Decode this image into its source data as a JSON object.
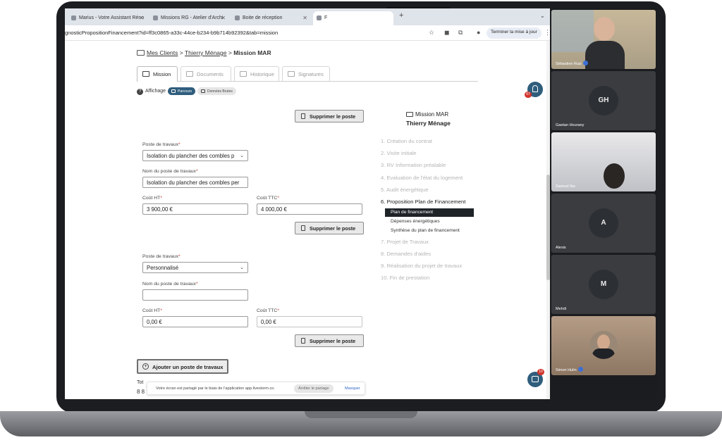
{
  "browser": {
    "tabs": [
      {
        "label": "Marius - Votre Assistant Réno"
      },
      {
        "label": "Missions RG - Atelier d'Archi"
      },
      {
        "label": "Boite de réception"
      },
      {
        "label": "F"
      }
    ],
    "url": "gnosticPropositionFinancement?id=ff3c0865-a33c-44ce-b234-b9b714b92392&tab=mission",
    "update_button": "Terminer la mise à jour"
  },
  "breadcrumb": {
    "clients": "Mes Clients",
    "sep1": ">",
    "client": "Thierry Ménage",
    "sep2": ">",
    "current": "Mission MAR"
  },
  "tabs": [
    {
      "label": "Mission"
    },
    {
      "label": "Documents"
    },
    {
      "label": "Historique"
    },
    {
      "label": "Signatures"
    }
  ],
  "display": {
    "label": "Affichage",
    "options": [
      "Parcours",
      "Données Brutes"
    ]
  },
  "delete_label": "Supprimer le poste",
  "postes": [
    {
      "type_label": "Poste de travaux",
      "type_value": "Isolation du plancher des combles p",
      "name_label": "Nom du poste de travaux",
      "name_value": "Isolation du plancher des combles per",
      "ht_label": "Coût HT",
      "ht_value": "3 900,00 €",
      "ttc_label": "Coût TTC",
      "ttc_value": "4 000,00 €"
    },
    {
      "type_label": "Poste de travaux",
      "type_value": "Personnalisé",
      "name_label": "Nom du poste de travaux",
      "name_value": "",
      "ht_label": "Coût HT",
      "ht_value": "0,00 €",
      "ttc_label": "Coût TTC",
      "ttc_value": "0,00 €"
    }
  ],
  "add_button": "Ajouter un poste de travaux",
  "total": {
    "label": "Tot",
    "value": "8 8"
  },
  "side_panel": {
    "title": "Mission MAR",
    "client": "Thierry Ménage",
    "steps": [
      "1. Création du contrat",
      "2. Visite initiale",
      "3. RV Information préalable",
      "4. Evaluation de l'état du logement",
      "5. Audit énergétique",
      "6. Proposition Plan de Financement",
      "7. Projet de Travaux",
      "8. Demandes d'aides",
      "9. Réalisation du projet de travaux",
      "10. Fin de prestation"
    ],
    "substeps": [
      "Plan de financement",
      "Dépenses énergétiques",
      "Synthèse du plan de financement"
    ]
  },
  "share_bar": {
    "text": "Votre écran est partagé par le biais de l'application app.livestorm.co.",
    "stop": "Arrêter le partage",
    "hide": "Masquer"
  },
  "notifications": {
    "bell_count": "67",
    "chat_count": "10"
  },
  "participants": [
    {
      "name": "Sébastien Ruiz",
      "initials": ""
    },
    {
      "name": "Gaetan Hourany",
      "initials": "GH"
    },
    {
      "name": "Samuel Ibo",
      "initials": ""
    },
    {
      "name": "Alexis",
      "initials": "A"
    },
    {
      "name": "Mehdi",
      "initials": "M"
    },
    {
      "name": "Simon Hulin",
      "initials": ""
    }
  ],
  "colors": {
    "accent": "#2f5d7c",
    "danger": "#d0342c",
    "meet_bg": "#1b1c1f"
  }
}
